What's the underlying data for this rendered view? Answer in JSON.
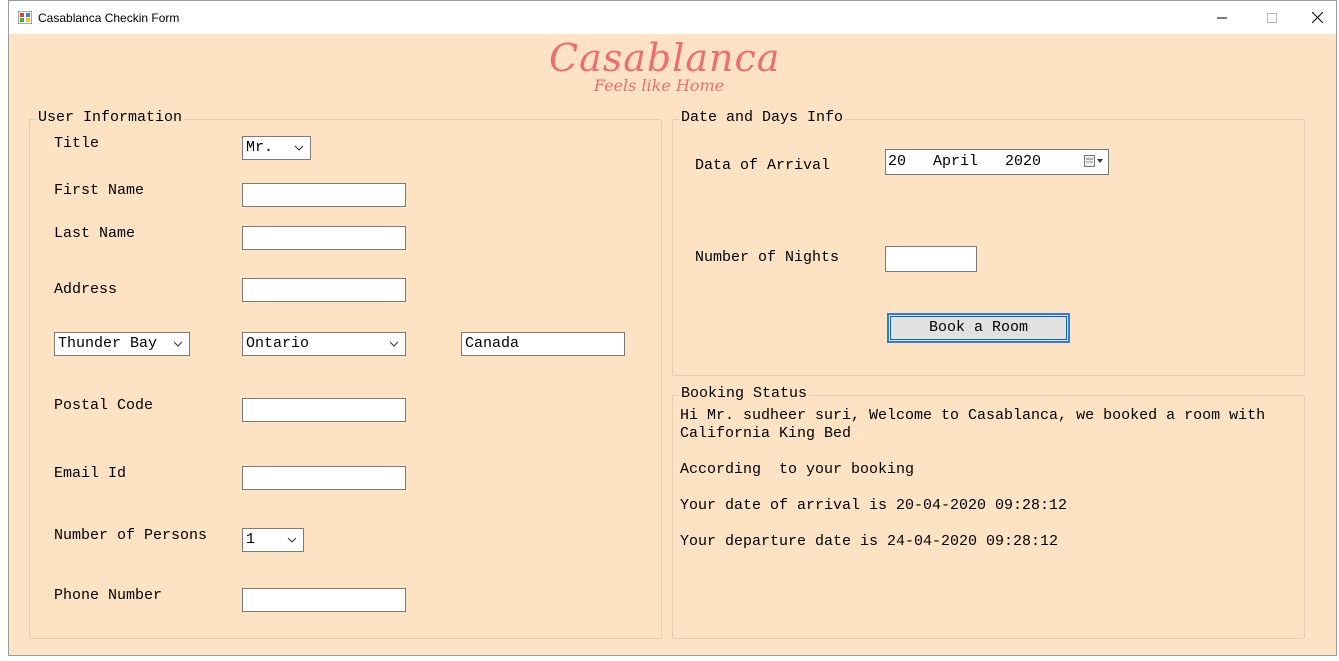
{
  "window": {
    "title": "Casablanca Checkin Form"
  },
  "brand": {
    "name": "Casablanca",
    "tagline": "Feels like Home"
  },
  "user_info": {
    "group_title": "User Information",
    "title_label": "Title",
    "title_value": "Mr.",
    "first_name_label": "First Name",
    "first_name_value": "",
    "last_name_label": "Last Name",
    "last_name_value": "",
    "address_label": "Address",
    "address_value": "",
    "city_value": "Thunder Bay",
    "province_value": "Ontario",
    "country_value": "Canada",
    "postal_code_label": "Postal Code",
    "postal_code_value": "",
    "email_label": "Email Id",
    "email_value": "",
    "persons_label": "Number of Persons",
    "persons_value": "1",
    "phone_label": "Phone Number",
    "phone_value": ""
  },
  "date_info": {
    "group_title": "Date and Days Info",
    "arrival_label": "Data of Arrival",
    "arrival_value": "20   April   2020",
    "nights_label": "Number of Nights",
    "nights_value": "",
    "book_button_label": "Book a Room"
  },
  "booking_status": {
    "group_title": "Booking Status",
    "lines": [
      "Hi Mr. sudheer suri, Welcome to Casablanca, we booked a room with California King Bed",
      "",
      "According  to your booking",
      "",
      "Your date of arrival is 20-04-2020 09:28:12",
      "",
      "Your departure date is 24-04-2020 09:28:12"
    ]
  },
  "colors": {
    "form_background": "#fde2c4",
    "brand": "#ec6e6e",
    "button_focus_border": "#2d7dd2"
  }
}
